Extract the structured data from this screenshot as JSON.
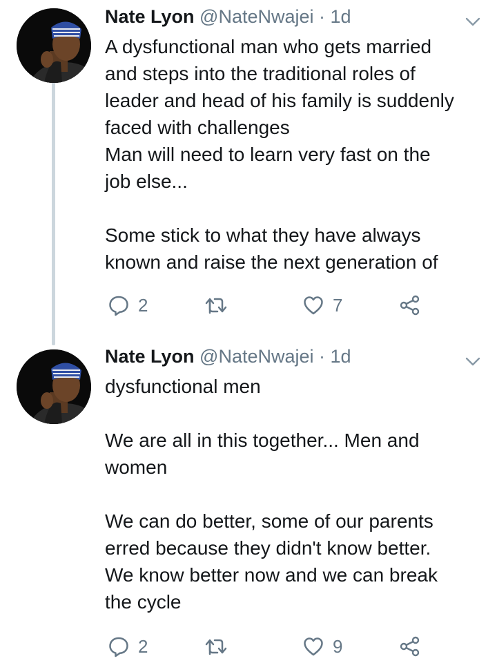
{
  "tweets": [
    {
      "name": "Nate Lyon",
      "handle": "@NateNwajei",
      "separator": "·",
      "time": "1d",
      "lines": [
        "A dysfunctional man who gets married",
        "and steps into the traditional roles of",
        "leader and head of his family is suddenly",
        "faced with challenges",
        "Man will need to learn very fast on the",
        "job else...",
        "",
        "Some stick to what they have always",
        "known and raise the next generation of"
      ],
      "reply_count": "2",
      "retweet_count": "",
      "like_count": "7"
    },
    {
      "name": "Nate Lyon",
      "handle": "@NateNwajei",
      "separator": "·",
      "time": "1d",
      "lines": [
        "dysfunctional men",
        "",
        "We are all in this together... Men and",
        "women",
        "",
        "We can do better, some of our parents",
        "erred because they didn't know better.",
        "We know better now and we can break",
        "the cycle"
      ],
      "reply_count": "2",
      "retweet_count": "",
      "like_count": "9"
    }
  ],
  "icons": {
    "reply": "reply-icon",
    "retweet": "retweet-icon",
    "like": "heart-icon",
    "share": "share-icon",
    "caret": "chevron-down-icon"
  },
  "colors": {
    "text": "#14171a",
    "secondary": "#657786",
    "thread_line": "#ccd6dd"
  }
}
